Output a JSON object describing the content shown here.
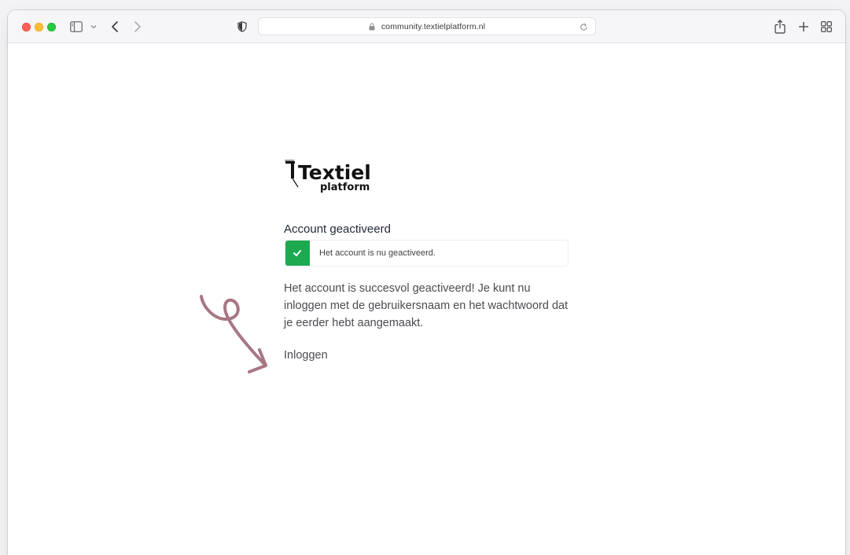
{
  "browser": {
    "url": "community.textielplatform.nl",
    "traffic_lights": [
      "close",
      "minimize",
      "zoom"
    ],
    "icons": [
      "sidebar-icon",
      "chevron-down-icon",
      "back-arrow-icon",
      "forward-arrow-icon",
      "privacy-shield-icon",
      "lock-icon",
      "reload-icon",
      "share-icon",
      "plus-icon",
      "tab-overview-icon"
    ]
  },
  "logo": {
    "word1": "Textiel",
    "word2": "platform"
  },
  "page": {
    "title": "Account geactiveerd",
    "alert_text": "Het account is nu geactiveerd.",
    "body_text": "Het account is succesvol geactiveerd! Je kunt nu inloggen met de gebruikersnaam en het wachtwoord dat je eerder hebt aangemaakt.",
    "login_link": "Inloggen"
  },
  "colors": {
    "success": "#1ea951",
    "annotation_arrow": "#a77783",
    "text": "#4b4b52"
  }
}
